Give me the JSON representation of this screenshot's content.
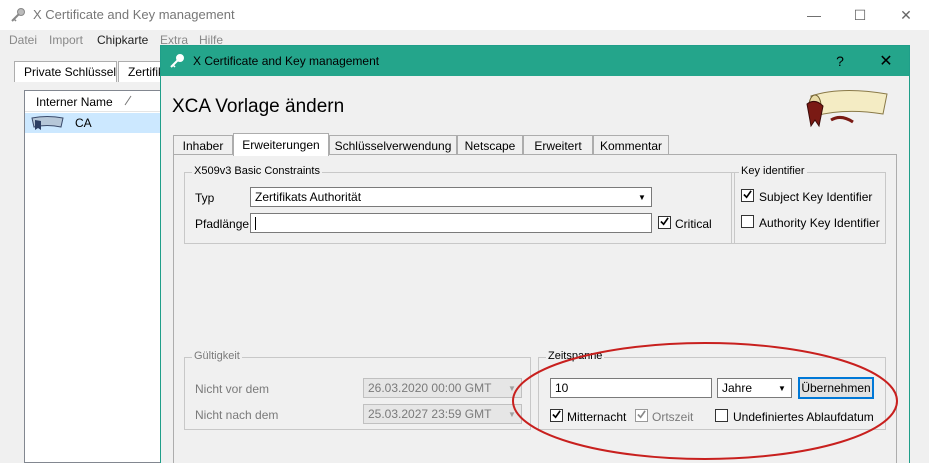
{
  "main_window": {
    "title": "X Certificate and Key management",
    "controls": {
      "minimize": "—",
      "maximize": "☐",
      "close": "✕"
    },
    "menu": [
      "Datei",
      "Import",
      "Chipkarte",
      "Extra",
      "Hilfe"
    ],
    "tabs": [
      "Private Schlüssel",
      "Zertifik"
    ],
    "list": {
      "column_header": "Interner Name",
      "rows": [
        {
          "label": "CA",
          "icon": "certificate-ca-icon"
        }
      ]
    }
  },
  "dialog": {
    "title": "X Certificate and Key management",
    "help_label": "?",
    "close_label": "✕",
    "heading": "XCA Vorlage ändern",
    "logo_icon": "scroll-certificate-icon",
    "accent_color": "#24a58b",
    "tabs": [
      {
        "label": "Inhaber",
        "active": false
      },
      {
        "label": "Erweiterungen",
        "active": true
      },
      {
        "label": "Schlüsselverwendung",
        "active": false
      },
      {
        "label": "Netscape",
        "active": false
      },
      {
        "label": "Erweitert",
        "active": false
      },
      {
        "label": "Kommentar",
        "active": false
      }
    ],
    "basic_constraints": {
      "title": "X509v3 Basic Constraints",
      "type_label": "Typ",
      "type_value": "Zertifikats Authorität",
      "pathlen_label": "Pfadlänge",
      "pathlen_value": "",
      "critical_label": "Critical",
      "critical_checked": true
    },
    "key_identifier": {
      "title": "Key identifier",
      "subject_label": "Subject Key Identifier",
      "subject_checked": true,
      "authority_label": "Authority Key Identifier",
      "authority_checked": false
    },
    "validity": {
      "title": "Gültigkeit",
      "not_before_label": "Nicht vor dem",
      "not_before_value": "26.03.2020 00:00 GMT",
      "not_after_label": "Nicht nach dem",
      "not_after_value": "25.03.2027 23:59 GMT"
    },
    "timespan": {
      "title": "Zeitspanne",
      "value": "10",
      "unit": "Jahre",
      "apply_label": "Übernehmen",
      "midnight_label": "Mitternacht",
      "midnight_checked": true,
      "localtime_label": "Ortszeit",
      "localtime_checked": true,
      "undefined_label": "Undefiniertes Ablaufdatum",
      "undefined_checked": false
    },
    "annotation_color": "#c8201e"
  }
}
